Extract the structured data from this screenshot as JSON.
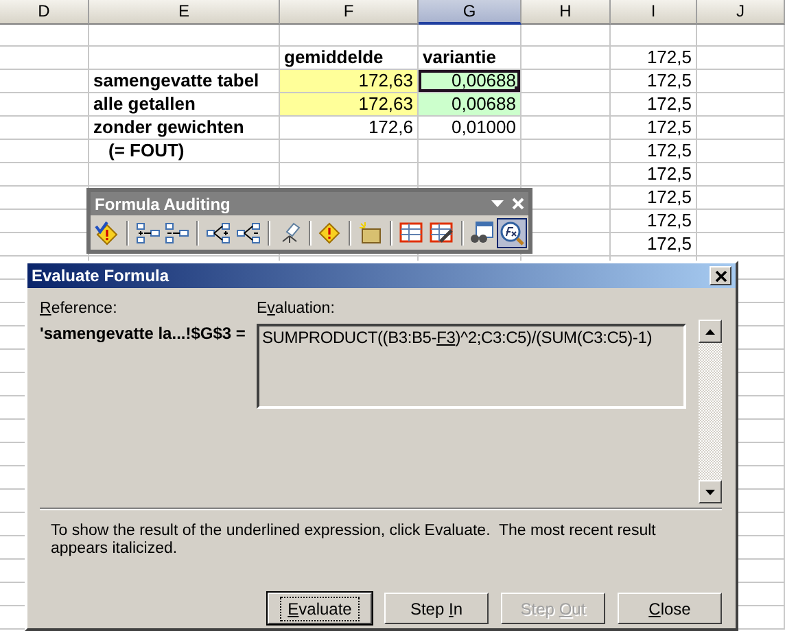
{
  "sheet": {
    "columns": [
      {
        "label": "D",
        "selected": false
      },
      {
        "label": "E",
        "selected": false
      },
      {
        "label": "F",
        "selected": false
      },
      {
        "label": "G",
        "selected": true
      },
      {
        "label": "H",
        "selected": false
      },
      {
        "label": "I",
        "selected": false
      },
      {
        "label": "J",
        "selected": false
      }
    ],
    "rows": [
      {
        "col_f": {
          "text": "gemiddelde",
          "kind": "heading",
          "selected": false
        },
        "col_g": {
          "text": "variantie",
          "kind": "heading",
          "selected": false
        },
        "col_i": {
          "text": "172,5",
          "kind": "number",
          "selected": false
        }
      },
      {
        "col_e": {
          "text": "samengevatte tabel",
          "kind": "label",
          "selected": false
        },
        "col_f": {
          "text": "172,63",
          "kind": "number",
          "color": "#ffff99",
          "selected": false
        },
        "col_g": {
          "text": "0,00688",
          "kind": "number",
          "color": "#ccffcc",
          "selected": true
        },
        "col_i": {
          "text": "172,5",
          "kind": "number",
          "selected": false
        }
      },
      {
        "col_e": {
          "text": "alle getallen",
          "kind": "label",
          "selected": false
        },
        "col_f": {
          "text": "172,63",
          "kind": "number",
          "color": "#ffff99",
          "selected": false
        },
        "col_g": {
          "text": "0,00688",
          "kind": "number",
          "color": "#ccffcc",
          "selected": false
        },
        "col_i": {
          "text": "172,5",
          "kind": "number",
          "selected": false
        }
      },
      {
        "col_e": {
          "text": "zonder gewichten",
          "kind": "label",
          "selected": false
        },
        "col_f": {
          "text": "172,6",
          "kind": "number",
          "selected": false
        },
        "col_g": {
          "text": "0,01000",
          "kind": "number",
          "selected": false
        },
        "col_i": {
          "text": "172,5",
          "kind": "number",
          "selected": false
        }
      },
      {
        "col_e": {
          "text": "(= FOUT)",
          "kind": "note",
          "selected": false
        },
        "col_i": {
          "text": "172,5",
          "kind": "number",
          "selected": false
        }
      },
      {
        "col_i": {
          "text": "172,5",
          "kind": "number",
          "selected": false
        }
      },
      {
        "col_i": {
          "text": "172,5",
          "kind": "number",
          "selected": false
        }
      },
      {
        "col_i": {
          "text": "172,5",
          "kind": "number",
          "selected": false
        }
      },
      {
        "col_i": {
          "text": "172,5",
          "kind": "number",
          "selected": false
        }
      }
    ]
  },
  "toolbar": {
    "title": "Formula Auditing",
    "buttons": [
      {
        "selected": false,
        "separator_before": false
      },
      {
        "selected": false,
        "separator_before": true
      },
      {
        "selected": false,
        "separator_before": false
      },
      {
        "selected": false,
        "separator_before": true
      },
      {
        "selected": false,
        "separator_before": false
      },
      {
        "selected": false,
        "separator_before": true
      },
      {
        "selected": false,
        "separator_before": true
      },
      {
        "selected": false,
        "separator_before": true
      },
      {
        "selected": false,
        "separator_before": true
      },
      {
        "selected": false,
        "separator_before": false
      },
      {
        "selected": false,
        "separator_before": true
      },
      {
        "selected": true,
        "separator_before": false
      }
    ]
  },
  "dialog": {
    "title": "Evaluate Formula",
    "reference_label": {
      "key": "R",
      "after": "eference:"
    },
    "reference": "'samengevatte la...!$G$3 =",
    "evaluation_label": {
      "before": "E",
      "key": "v",
      "after": "aluation:"
    },
    "formula": {
      "before": "SUMPRODUCT((B3:B5-",
      "underlined": "F3",
      "after": ")^2;C3:C5)/(SUM(C3:C5)-1)"
    },
    "help": "To show the result of the underlined expression, click Evaluate.  The most recent result appears italicized.",
    "buttons": [
      {
        "label": {
          "key": "E",
          "after": "valuate"
        },
        "default": true,
        "disabled": false
      },
      {
        "label": {
          "before": "Step ",
          "key": "I",
          "after": "n"
        },
        "default": false,
        "disabled": false
      },
      {
        "label": {
          "before": "Step ",
          "key": "O",
          "after": "ut"
        },
        "default": false,
        "disabled": true
      },
      {
        "label": {
          "key": "C",
          "after": "lose"
        },
        "default": false,
        "disabled": false
      }
    ]
  }
}
